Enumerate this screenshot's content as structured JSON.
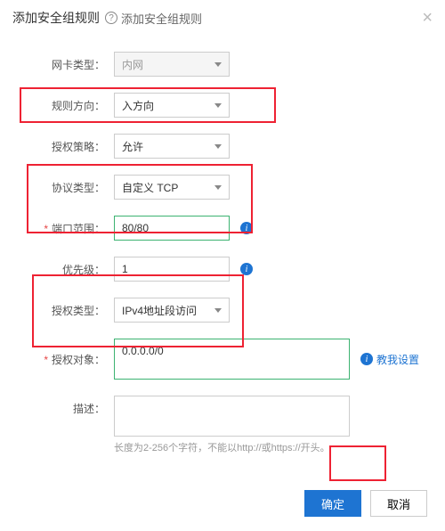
{
  "header": {
    "title": "添加安全组规则",
    "help_icon": "?",
    "subtitle": "添加安全组规则"
  },
  "close_glyph": "×",
  "labels": {
    "nic_type": "网卡类型：",
    "direction": "规则方向：",
    "auth_policy": "授权策略：",
    "protocol": "协议类型：",
    "port_range": "端口范围：",
    "priority": "优先级：",
    "auth_type": "授权类型：",
    "auth_object": "授权对象：",
    "description": "描述："
  },
  "values": {
    "nic_type": "内网",
    "direction": "入方向",
    "auth_policy": "允许",
    "protocol": "自定义 TCP",
    "port_range": "80/80",
    "priority": "1",
    "auth_type": "IPv4地址段访问",
    "auth_object": "0.0.0.0/0",
    "description": ""
  },
  "hints": {
    "description": "长度为2-256个字符，不能以http://或https://开头。"
  },
  "teach_link": "教我设置",
  "buttons": {
    "ok": "确定",
    "cancel": "取消"
  },
  "info_glyph": "i"
}
